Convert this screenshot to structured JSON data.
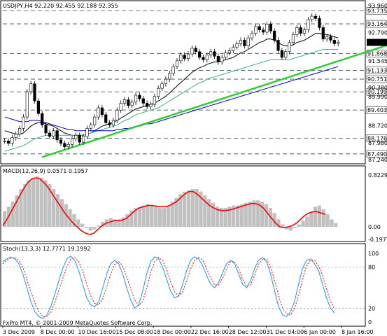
{
  "colors": {
    "price_bar": "#000000",
    "trendline": "#32CD32",
    "ma_fast": "#000000",
    "ma_mid": "#3CB371",
    "ma_slow": "#0000CD",
    "macd_hist": "#C0C0C0",
    "macd_signal": "#FF0000",
    "stoch_main": "#1E90FF",
    "stoch_signal": "#FF0000",
    "level_line": "#2F4F4F",
    "current_price_bg": "#000000"
  },
  "chart_data": [
    {
      "type": "candlestick",
      "title": "USDJPY,H4  92.220 92.455 92.188 92.355",
      "ylim": [
        87.24,
        93.96
      ],
      "y_ticks": [
        "93.960",
        "92.790",
        "91.545",
        "90.380",
        "89.990",
        "88.720",
        "87.980",
        "87.240"
      ],
      "level_labels": [
        "93.735",
        "93.164",
        "91.868",
        "91.133",
        "90.751",
        "90.199",
        "89.403",
        "88.176",
        "87.490"
      ],
      "level_values": [
        93.735,
        93.164,
        91.868,
        91.133,
        90.751,
        90.199,
        89.403,
        88.176,
        87.49
      ],
      "current_price_label": "92.355",
      "current_price": 92.355,
      "close": [
        88.05,
        87.95,
        88.2,
        88.35,
        88.6,
        89.1,
        90.2,
        90.55,
        89.8,
        89.25,
        88.75,
        88.4,
        88.25,
        88.5,
        88.1,
        87.95,
        87.8,
        87.9,
        88.15,
        88.3,
        88.0,
        88.25,
        88.6,
        88.75,
        89.1,
        89.5,
        89.2,
        88.85,
        88.75,
        88.95,
        89.4,
        89.7,
        89.85,
        89.6,
        89.75,
        90.05,
        89.9,
        89.7,
        89.55,
        89.65,
        90.0,
        90.35,
        90.55,
        90.75,
        91.0,
        91.3,
        91.55,
        91.8,
        91.65,
        91.85,
        92.1,
        91.95,
        91.7,
        91.6,
        91.8,
        91.95,
        91.75,
        91.5,
        91.7,
        91.9,
        92.0,
        92.15,
        92.3,
        92.45,
        92.2,
        92.55,
        92.75,
        93.05,
        92.9,
        92.8,
        93.15,
        92.85,
        92.45,
        92.0,
        91.7,
        91.95,
        92.35,
        92.7,
        93.0,
        92.75,
        92.9,
        93.35,
        93.5,
        93.4,
        93.0,
        92.5,
        92.6,
        92.45,
        92.3,
        92.35
      ],
      "x_labels": [
        "3 Dec 2009",
        "8 Dec 00:00",
        "10 Dec 16:00",
        "15 Dec 08:00",
        "18 Dec 00:00",
        "22 Dec 16:00",
        "28 Dec 12:00",
        "31 Dec 04:00",
        "6 Jan 00:00",
        "8 Jan 16:00"
      ],
      "series": [
        {
          "name": "MA fast",
          "values": [
            88.5,
            88.45,
            88.4,
            88.35,
            88.35,
            88.4,
            88.55,
            88.7,
            88.8,
            88.85,
            88.85,
            88.8,
            88.75,
            88.7,
            88.6,
            88.5,
            88.4,
            88.35,
            88.3,
            88.3,
            88.3,
            88.3,
            88.35,
            88.4,
            88.5,
            88.6,
            88.7,
            88.75,
            88.8,
            88.85,
            88.95,
            89.05,
            89.15,
            89.25,
            89.35,
            89.45,
            89.5,
            89.55,
            89.6,
            89.65,
            89.7,
            89.8,
            89.9,
            90.0,
            90.15,
            90.3,
            90.45,
            90.6,
            90.75,
            90.9,
            91.05,
            91.15,
            91.25,
            91.3,
            91.4,
            91.45,
            91.5,
            91.5,
            91.55,
            91.6,
            91.65,
            91.7,
            91.8,
            91.9,
            91.95,
            92.05,
            92.15,
            92.25,
            92.35,
            92.4,
            92.5,
            92.5,
            92.45,
            92.35,
            92.25,
            92.2,
            92.2,
            92.25,
            92.35,
            92.4,
            92.45,
            92.55,
            92.65,
            92.75,
            92.75,
            92.7,
            92.7,
            92.65,
            92.6,
            92.55
          ]
        },
        {
          "name": "MA mid",
          "values": [
            87.6,
            87.65,
            87.7,
            87.75,
            87.8,
            87.85,
            87.95,
            88.05,
            88.15,
            88.2,
            88.25,
            88.3,
            88.3,
            88.3,
            88.3,
            88.3,
            88.3,
            88.3,
            88.3,
            88.3,
            88.3,
            88.3,
            88.35,
            88.4,
            88.45,
            88.5,
            88.55,
            88.6,
            88.65,
            88.7,
            88.75,
            88.85,
            88.95,
            89.0,
            89.1,
            89.2,
            89.25,
            89.3,
            89.35,
            89.4,
            89.45,
            89.5,
            89.6,
            89.7,
            89.8,
            89.9,
            90.0,
            90.1,
            90.2,
            90.3,
            90.4,
            90.5,
            90.6,
            90.65,
            90.75,
            90.8,
            90.85,
            90.9,
            90.95,
            91.0,
            91.05,
            91.1,
            91.15,
            91.2,
            91.25,
            91.3,
            91.35,
            91.4,
            91.45,
            91.5,
            91.55,
            91.6,
            91.6,
            91.6,
            91.6,
            91.6,
            91.6,
            91.65,
            91.7,
            91.75,
            91.8,
            91.85,
            91.9,
            91.95,
            92.0,
            92.05,
            92.05,
            92.05,
            92.05,
            92.05
          ]
        },
        {
          "name": "MA slow",
          "values": [
            89.1,
            89.05,
            89.0,
            88.95,
            88.9,
            88.9,
            88.9,
            88.95,
            88.95,
            88.95,
            88.9,
            88.85,
            88.8,
            88.75,
            88.7,
            88.65,
            88.6,
            88.55,
            88.55,
            88.5,
            88.5,
            88.5,
            88.5,
            88.5,
            88.5,
            88.5,
            88.5,
            88.5,
            88.5,
            88.5,
            88.55,
            88.55,
            88.6,
            88.6,
            88.65,
            88.7,
            88.7,
            88.75,
            88.8,
            88.8,
            88.85,
            88.9,
            88.95,
            89.0,
            89.05,
            89.1,
            89.15,
            89.2,
            89.25,
            89.3,
            89.35,
            89.4,
            89.45,
            89.5,
            89.55,
            89.6,
            89.65,
            89.7,
            89.75,
            89.8,
            89.85,
            89.9,
            89.95,
            90.0,
            90.05,
            90.1,
            90.15,
            90.2,
            90.25,
            90.3,
            90.35,
            90.4,
            90.45,
            90.5,
            90.55,
            90.6,
            90.65,
            90.7,
            90.75,
            90.8,
            90.85,
            90.9,
            90.95,
            91.0,
            91.05,
            91.1,
            91.15,
            91.2,
            91.25,
            91.3
          ]
        }
      ],
      "trendline": {
        "from": [
          10,
          87.35
        ],
        "to": [
          127,
          93.55
        ]
      }
    },
    {
      "type": "bar",
      "title": "MACD(12,26,9) 0.0571 0.1957",
      "ylim": [
        -0.1977,
        0.8229
      ],
      "y_ticks": [
        "0.8229",
        "0.00",
        "-0.1977"
      ],
      "series": [
        {
          "name": "histogram",
          "values": [
            0.25,
            0.32,
            0.4,
            0.5,
            0.6,
            0.68,
            0.74,
            0.78,
            0.8,
            0.78,
            0.74,
            0.68,
            0.6,
            0.52,
            0.44,
            0.36,
            0.28,
            0.2,
            0.12,
            0.05,
            -0.02,
            -0.06,
            -0.04,
            0.02,
            0.08,
            0.12,
            0.14,
            0.12,
            0.12,
            0.15,
            0.2,
            0.26,
            0.3,
            0.32,
            0.34,
            0.36,
            0.34,
            0.32,
            0.3,
            0.3,
            0.34,
            0.4,
            0.46,
            0.52,
            0.56,
            0.58,
            0.6,
            0.6,
            0.56,
            0.5,
            0.44,
            0.38,
            0.32,
            0.3,
            0.3,
            0.32,
            0.34,
            0.34,
            0.36,
            0.38,
            0.4,
            0.42,
            0.42,
            0.4,
            0.36,
            0.3,
            0.22,
            0.12,
            0.04,
            -0.04,
            -0.06,
            -0.02,
            0.04,
            0.1,
            0.16,
            0.24,
            0.32,
            0.34,
            0.28,
            0.2,
            0.12,
            0.06
          ]
        },
        {
          "name": "signal",
          "values": [
            0.02,
            0.12,
            0.24,
            0.36,
            0.48,
            0.6,
            0.7,
            0.76,
            0.78,
            0.76,
            0.7,
            0.62,
            0.52,
            0.42,
            0.32,
            0.22,
            0.14,
            0.06,
            0.0,
            -0.06,
            -0.1,
            -0.12,
            -0.1,
            -0.04,
            0.02,
            0.06,
            0.08,
            0.1,
            0.1,
            0.11,
            0.14,
            0.2,
            0.26,
            0.3,
            0.32,
            0.34,
            0.34,
            0.33,
            0.32,
            0.32,
            0.33,
            0.36,
            0.4,
            0.46,
            0.52,
            0.56,
            0.56,
            0.52,
            0.46,
            0.4,
            0.34,
            0.3,
            0.27,
            0.26,
            0.26,
            0.27,
            0.29,
            0.31,
            0.33,
            0.35,
            0.37,
            0.37,
            0.35,
            0.3,
            0.22,
            0.14,
            0.06,
            0.0,
            -0.01,
            0.0,
            0.02,
            0.06,
            0.12,
            0.18,
            0.22,
            0.24,
            0.24,
            0.22,
            0.2
          ]
        }
      ]
    },
    {
      "type": "line",
      "title": "Stoch(13,3,3) 12.7771 19.1992",
      "ylim": [
        0,
        100
      ],
      "y_ticks": [
        "100",
        "80",
        "20",
        "0"
      ],
      "series": [
        {
          "name": "main",
          "values": [
            88,
            92,
            95,
            92,
            85,
            70,
            50,
            30,
            15,
            8,
            5,
            10,
            22,
            40,
            60,
            78,
            92,
            96,
            90,
            75,
            55,
            35,
            25,
            22,
            30,
            50,
            70,
            85,
            90,
            85,
            70,
            50,
            32,
            20,
            25,
            45,
            70,
            88,
            95,
            92,
            80,
            62,
            45,
            35,
            38,
            55,
            75,
            90,
            95,
            92,
            82,
            68,
            55,
            50,
            58,
            72,
            85,
            90,
            85,
            70,
            55,
            50,
            60,
            78,
            90,
            94,
            88,
            70,
            45,
            22,
            10,
            8,
            15,
            30,
            55,
            78,
            90,
            92,
            85,
            75,
            55,
            35,
            20,
            13
          ]
        },
        {
          "name": "signal",
          "values": [
            85,
            90,
            93,
            94,
            90,
            80,
            62,
            45,
            28,
            15,
            8,
            8,
            14,
            28,
            46,
            64,
            80,
            92,
            94,
            88,
            74,
            55,
            38,
            27,
            25,
            34,
            52,
            70,
            84,
            88,
            82,
            66,
            48,
            32,
            24,
            30,
            50,
            72,
            88,
            94,
            90,
            76,
            58,
            44,
            38,
            44,
            60,
            78,
            90,
            94,
            90,
            78,
            64,
            54,
            54,
            64,
            78,
            88,
            88,
            78,
            62,
            52,
            54,
            68,
            84,
            92,
            92,
            80,
            60,
            38,
            20,
            12,
            10,
            20,
            38,
            62,
            82,
            90,
            90,
            82,
            68,
            48,
            30,
            19
          ]
        }
      ]
    }
  ],
  "footer": {
    "copyright": "FxPro MT4, © 2001-2009 MetaQuotes Software Corp."
  }
}
